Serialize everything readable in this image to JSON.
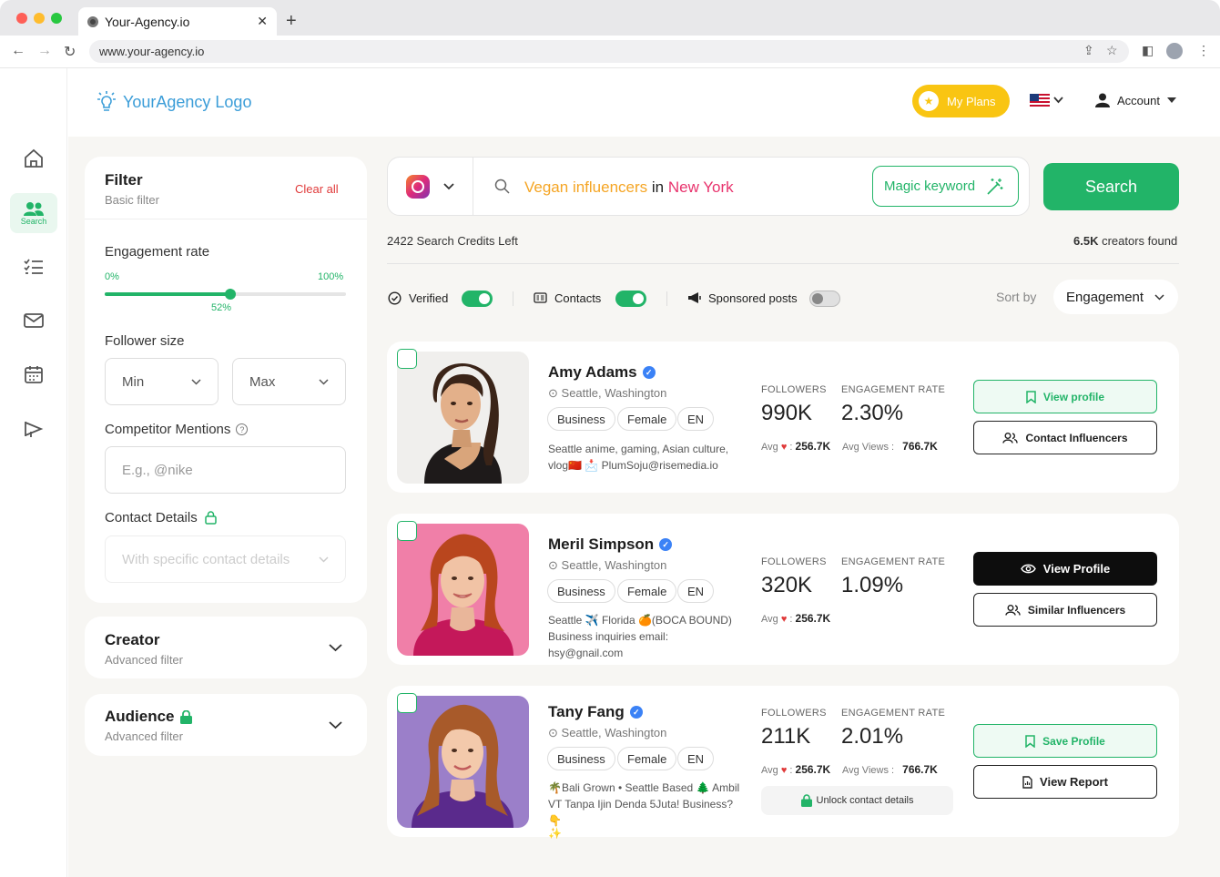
{
  "browser": {
    "tab_title": "Your-Agency.io",
    "url": "www.your-agency.io"
  },
  "header": {
    "logo_text": "YourAgency Logo",
    "my_plans": "My Plans",
    "account": "Account"
  },
  "sidebar": {
    "search_label": "Search"
  },
  "filter": {
    "title": "Filter",
    "subtitle": "Basic filter",
    "clear_all": "Clear all",
    "engagement_label": "Engagement rate",
    "min_pct": "0%",
    "max_pct": "100%",
    "current_pct": "52%",
    "engagement_value": 0.52,
    "follower_label": "Follower size",
    "min": "Min",
    "max": "Max",
    "competitor_label": "Competitor Mentions",
    "competitor_placeholder": "E.g., @nike",
    "contact_label": "Contact Details",
    "contact_placeholder": "With specific contact details"
  },
  "creator": {
    "title": "Creator",
    "subtitle": "Advanced filter"
  },
  "audience": {
    "title": "Audience",
    "subtitle": "Advanced filter"
  },
  "search": {
    "query_prefix": "Vegan influencers",
    "query_in": "in",
    "query_location": "New York",
    "magic": "Magic keyword",
    "button": "Search"
  },
  "results": {
    "credits": "2422 Search Credits Left",
    "found_count": "6.5K",
    "found_label": "creators found"
  },
  "toggles": {
    "verified": "Verified",
    "contacts": "Contacts",
    "sponsored": "Sponsored posts",
    "sort_by": "Sort by",
    "sort_value": "Engagement"
  },
  "labels": {
    "followers": "FOLLOWERS",
    "engagement": "ENGAGEMENT RATE",
    "avg": "Avg",
    "avg_views": "Avg Views :"
  },
  "profiles": [
    {
      "name": "Amy Adams",
      "location": "Seattle, Washington",
      "tags": [
        "Business",
        "Female",
        "EN"
      ],
      "bio1": "Seattle anime, gaming, Asian culture,",
      "bio2": "vlog🇨🇳 📩 PlumSoju@risemedia.io",
      "followers": "990K",
      "engagement": "2.30%",
      "avg_likes": "256.7K",
      "avg_views": "766.7K",
      "btn1": "View profile",
      "btn2": "Contact Influencers"
    },
    {
      "name": "Meril Simpson",
      "location": "Seattle, Washington",
      "tags": [
        "Business",
        "Female",
        "EN"
      ],
      "bio1": "Seattle ✈️ Florida 🍊(BOCA BOUND)",
      "bio2": "Business inquiries email: hsy@gnail.com",
      "followers": "320K",
      "engagement": "1.09%",
      "avg_likes": "256.7K",
      "btn1": "View Profile",
      "btn2": "Similar Influencers"
    },
    {
      "name": "Tany Fang",
      "location": "Seattle, Washington",
      "tags": [
        "Business",
        "Female",
        "EN"
      ],
      "bio1": "🌴Bali Grown • Seattle Based 🌲 Ambil",
      "bio2": "VT Tanpa Ijin Denda 5Juta! Business?👇",
      "bio3": "✨",
      "followers": "211K",
      "engagement": "2.01%",
      "avg_likes": "256.7K",
      "avg_views": "766.7K",
      "unlock": "Unlock contact details",
      "btn1": "Save Profile",
      "btn2": "View Report"
    }
  ],
  "colors": {
    "accent": "#22b468",
    "orange": "#f5a524",
    "pink": "#e8336d",
    "yellow": "#f9c512"
  }
}
